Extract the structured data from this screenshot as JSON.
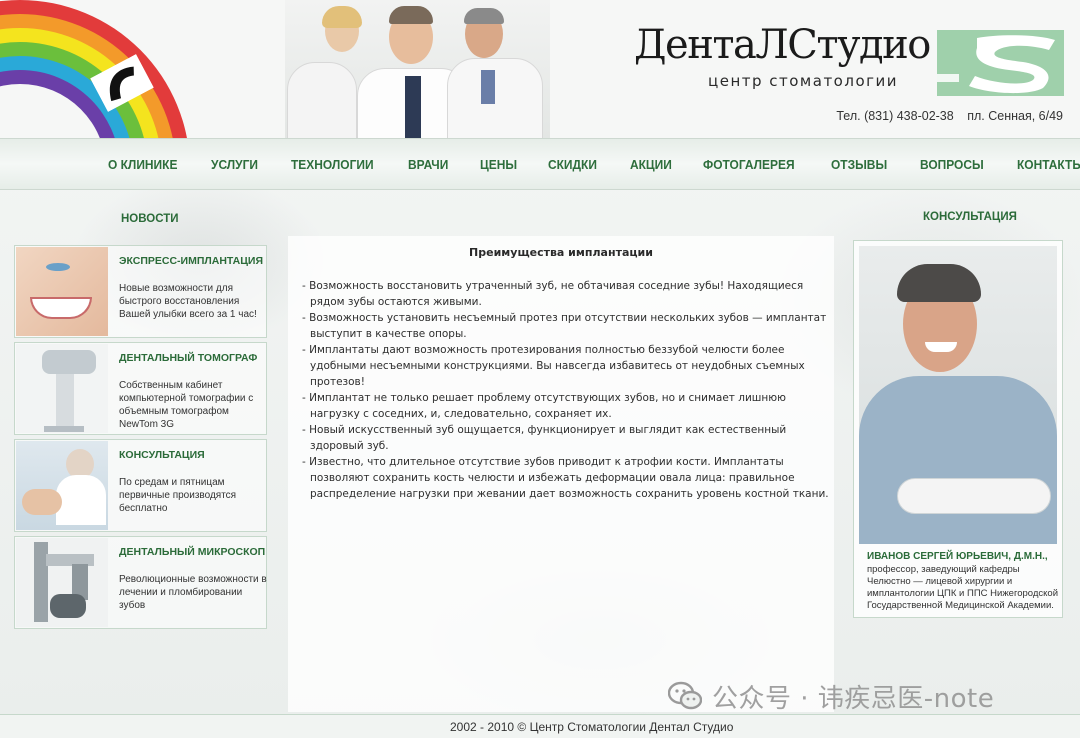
{
  "brand": {
    "name": "ДентаЛСтудио",
    "subtitle": "центр стоматологии",
    "phone": "Тел. (831) 438-02-38",
    "address": "пл. Сенная, 6/49"
  },
  "nav": {
    "items": [
      "О КЛИНИКЕ",
      "УСЛУГИ",
      "ТЕХНОЛОГИИ",
      "ВРАЧИ",
      "ЦЕНЫ",
      "СКИДКИ",
      "АКЦИИ",
      "ФОТОГАЛЕРЕЯ",
      "ОТЗЫВЫ",
      "ВОПРОСЫ",
      "КОНТАКТЫ"
    ]
  },
  "news": {
    "title": "НОВОСТИ",
    "items": [
      {
        "title": "ЭКСПРЕСС-ИМПЛАНТАЦИЯ",
        "text": "Новые возможности для быстрого восстановления Вашей улыбки всего за 1 час!"
      },
      {
        "title": "ДЕНТАЛЬНЫЙ ТОМОГРАФ",
        "text": "Собственным кабинет компьютерной томографии с объемным томографом NewTom 3G"
      },
      {
        "title": "КОНСУЛЬТАЦИЯ",
        "text": "По средам и пятницам первичные производятся бесплатно"
      },
      {
        "title": "ДЕНТАЛЬНЫЙ МИКРОСКОП",
        "text": "Революционные возможности в лечении и пломбировании зубов"
      }
    ]
  },
  "article": {
    "title": "Преимущества имплантации",
    "paragraphs": [
      "- Возможность восстановить утраченный зуб, не обтачивая соседние зубы! Находящиеся рядом зубы остаются живыми.",
      "- Возможность установить несъемный протез при отсутствии нескольких зубов — имплантат выступит в качестве опоры.",
      "- Имплантаты дают возможность протезирования полностью беззубой челюсти более удобными несъемными конструкциями. Вы навсегда избавитесь от неудобных съемных протезов!",
      "- Имплантат не только решает проблему отсутствующих зубов, но и снимает лишнюю нагрузку с соседних, и, следовательно, сохраняет их.",
      "- Новый искусственный зуб ощущается, функционирует и выглядит как естественный здоровый зуб.",
      "- Известно, что длительное отсутствие зубов приводит к атрофии кости. Имплантаты позволяют сохранить кость челюсти и избежать деформации овала лица: правильное распределение нагрузки при жевании дает возможность сохранить уровень костной ткани."
    ]
  },
  "consult": {
    "title": "КОНСУЛЬТАЦИЯ",
    "doctor_name": "ИВАНОВ СЕРГЕЙ ЮРЬЕВИЧ, Д.М.Н.,",
    "doctor_desc": "профессор, заведующий кафедры Челюстно — лицевой хирургии и имплантологии ЦПК и ППС Нижегородской Государственной Медицинской Академии."
  },
  "watermark": {
    "text": "公众号 · 讳疾忌医-note",
    "icon": "wechat-icon"
  },
  "footer": {
    "text": "2002 - 2010 © Центр Стоматологии Дентал Студио"
  },
  "colors": {
    "accent_green": "#2e6e3c",
    "logo_box": "#9fd0ab",
    "border": "#c6d8cb"
  }
}
